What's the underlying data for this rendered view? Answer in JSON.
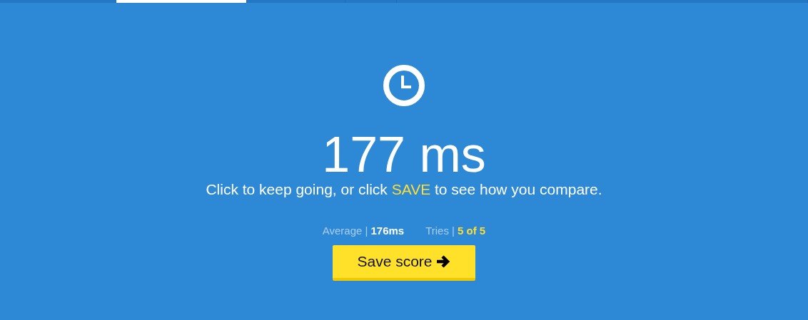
{
  "tabs": [
    {
      "selected": false
    },
    {
      "selected": true
    },
    {
      "selected": false
    },
    {
      "selected": false
    },
    {
      "selected": false
    }
  ],
  "result": "177 ms",
  "message": {
    "before": "Click to keep going, or click ",
    "highlight": "SAVE",
    "after": " to see how you compare."
  },
  "stats": [
    {
      "label": "Average |",
      "value": "176ms",
      "kind": "plain"
    },
    {
      "label": "Tries |",
      "value": "5 of 5",
      "kind": "highlight"
    }
  ],
  "button": {
    "label": "Save score"
  }
}
